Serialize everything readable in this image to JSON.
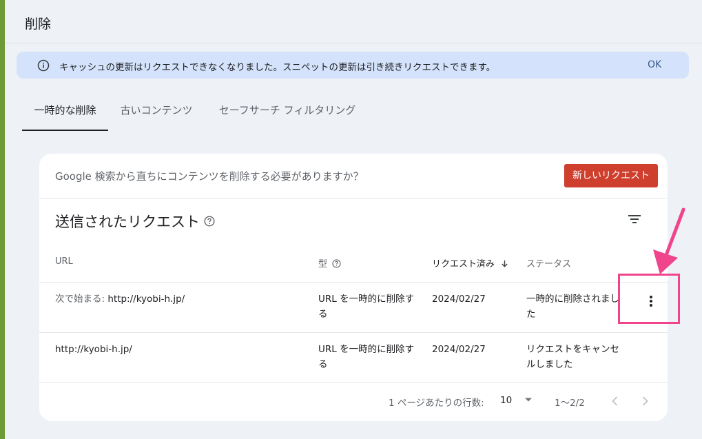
{
  "page": {
    "title": "削除"
  },
  "banner": {
    "icon": "info-icon",
    "message": "キャッシュの更新はリクエストできなくなりました。スニペットの更新は引き続きリクエストできます。",
    "ok_label": "OK"
  },
  "tabs": [
    {
      "label": "一時的な削除",
      "active": true
    },
    {
      "label": "古いコンテンツ",
      "active": false
    },
    {
      "label": "セーフサーチ フィルタリング",
      "active": false
    }
  ],
  "card": {
    "question": "Google 検索から直ちにコンテンツを削除する必要がありますか？",
    "new_request_label": "新しいリクエスト",
    "section_title": "送信されたリクエスト",
    "columns": {
      "url": "URL",
      "type": "型",
      "requested": "リクエスト済み",
      "status": "ステータス"
    },
    "rows": [
      {
        "url_prefix": "次で始まる: ",
        "url": "http://kyobi-h.jp/",
        "type_line1": "URL を一時的に削除す",
        "type_line2": "る",
        "date": "2024/02/27",
        "status_line1": "一時的に削除されまし",
        "status_line2": "た"
      },
      {
        "url_prefix": "",
        "url": "http://kyobi-h.jp/",
        "type_line1": "URL を一時的に削除す",
        "type_line2": "る",
        "date": "2024/02/27",
        "status_line1": "リクエストをキャンセ",
        "status_line2": "ルしました"
      }
    ],
    "pagination": {
      "rows_per_page_label": "1 ページあたりの行数:",
      "rows_per_page_value": "10",
      "range": "1〜2/2"
    }
  },
  "colors": {
    "accent_red": "#cf3f2e",
    "banner_bg": "#d4e3fb",
    "annotation_pink": "#f0458c",
    "page_bg": "#eef1f6"
  }
}
